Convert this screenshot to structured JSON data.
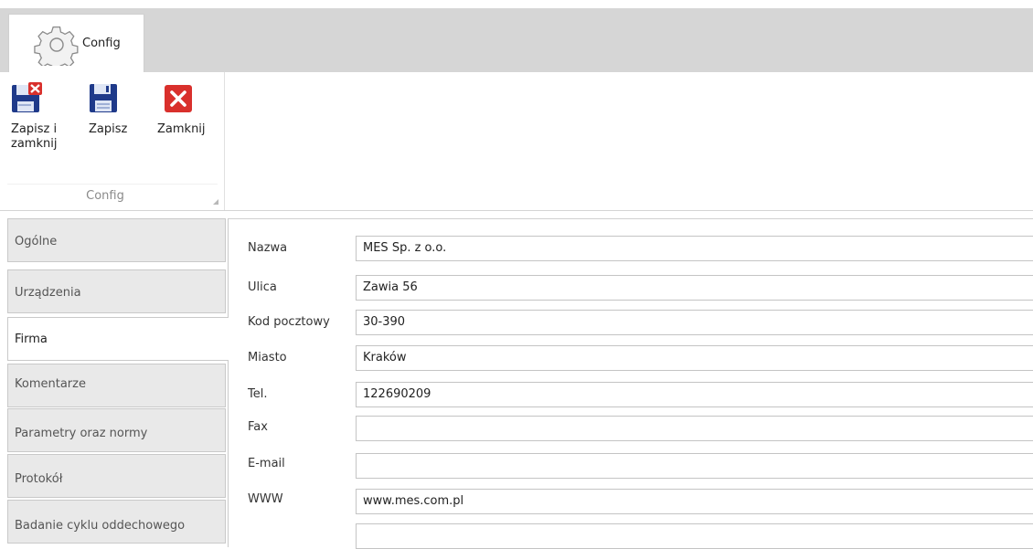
{
  "ribbon": {
    "tab_label": "Config",
    "tab_icon": "gear-icon",
    "buttons": [
      {
        "name": "save-and-close-button",
        "label": "Zapisz i zamknij",
        "icon": "save-close-icon"
      },
      {
        "name": "save-button",
        "label": "Zapisz",
        "icon": "save-icon"
      },
      {
        "name": "close-button",
        "label": "Zamknij",
        "icon": "close-icon"
      }
    ],
    "group_caption": "Config",
    "colors": {
      "floppy": "#1f3a8a",
      "red": "#d9302c"
    }
  },
  "nav": {
    "items": [
      {
        "label": "Ogólne"
      },
      {
        "label": "Urządzenia"
      },
      {
        "label": "Firma",
        "active": true
      },
      {
        "label": "Komentarze"
      },
      {
        "label": "Parametry oraz normy"
      },
      {
        "label": "Protokół"
      },
      {
        "label": "Badanie cyklu oddechowego"
      }
    ]
  },
  "form": {
    "fields": [
      {
        "label": "Nazwa",
        "value": "MES Sp. z o.o."
      },
      {
        "label": "Ulica",
        "value": "Zawia 56"
      },
      {
        "label": "Kod pocztowy",
        "value": "30-390"
      },
      {
        "label": "Miasto",
        "value": "Kraków"
      },
      {
        "label": "Tel.",
        "value": "122690209"
      },
      {
        "label": "Fax",
        "value": ""
      },
      {
        "label": "E-mail",
        "value": ""
      },
      {
        "label": "WWW",
        "value": "www.mes.com.pl"
      },
      {
        "label": "",
        "value": ""
      }
    ]
  }
}
